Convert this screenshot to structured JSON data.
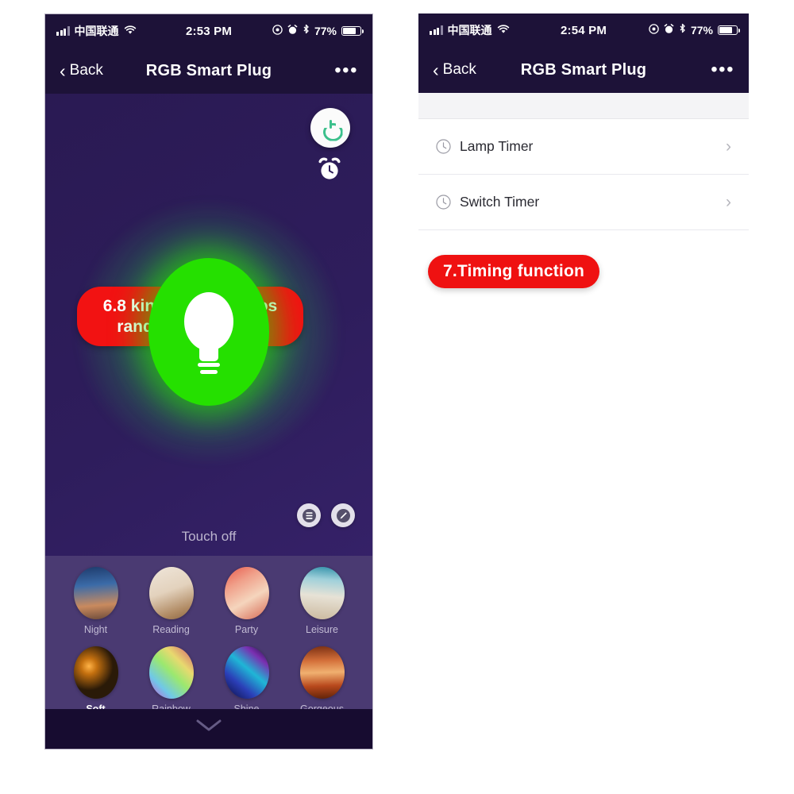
{
  "colors": {
    "accent_red": "#f21212",
    "bulb_green": "#25e000",
    "power_green": "#3cc08c",
    "nav_dark": "#1d1238",
    "app_bg": "#2e1d5c",
    "scene_panel": "#4a3a72"
  },
  "phone_left": {
    "status": {
      "carrier": "中国联通",
      "time": "2:53 PM",
      "battery_text": "77%",
      "battery_level": 77,
      "icons": [
        "signal-bars-icon",
        "wifi-icon",
        "location-icon",
        "alarm-icon",
        "bluetooth-icon",
        "battery-icon"
      ]
    },
    "nav": {
      "back_label": "Back",
      "title": "RGB Smart Plug",
      "more_label": "•••"
    },
    "callout": "6.8 kinds of scenarios randomly selected",
    "power_button_label": "power-toggle",
    "alarm_button_label": "alarm-shortcut",
    "bulb_state_label": "Touch off",
    "mini_buttons": [
      {
        "name": "list-button",
        "label": "list"
      },
      {
        "name": "edit-button",
        "label": "edit"
      }
    ],
    "scenes_row1": [
      {
        "label": "Night",
        "selected": false
      },
      {
        "label": "Reading",
        "selected": false
      },
      {
        "label": "Party",
        "selected": false
      },
      {
        "label": "Leisure",
        "selected": false
      }
    ],
    "scenes_row2": [
      {
        "label": "Soft",
        "selected": true
      },
      {
        "label": "Rainbow",
        "selected": false
      },
      {
        "label": "Shine",
        "selected": false
      },
      {
        "label": "Gorgeous",
        "selected": false
      }
    ],
    "footer_collapse_label": "collapse"
  },
  "phone_right": {
    "status": {
      "carrier": "中国联通",
      "time": "2:54 PM",
      "battery_text": "77%",
      "battery_level": 77
    },
    "nav": {
      "back_label": "Back",
      "title": "RGB Smart Plug",
      "more_label": "•••"
    },
    "rows": [
      {
        "label": "Lamp Timer",
        "chevron": "›"
      },
      {
        "label": "Switch Timer",
        "chevron": "›"
      }
    ],
    "callout": "7.Timing function"
  }
}
